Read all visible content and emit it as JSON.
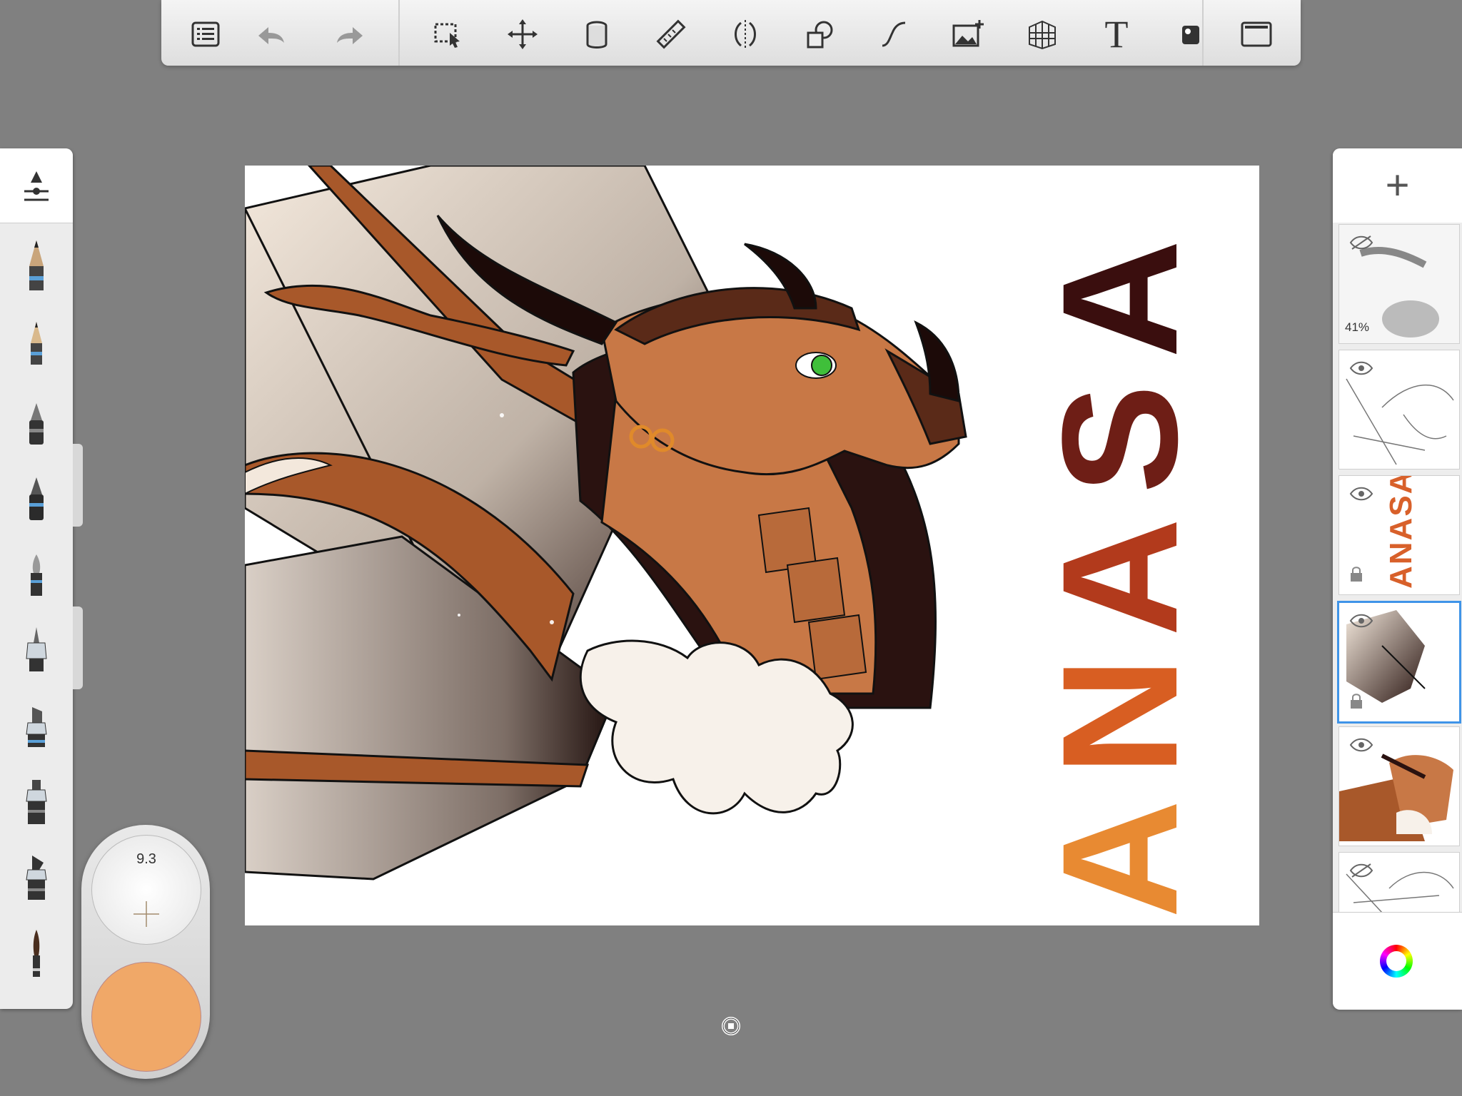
{
  "toolbar": {
    "tools": [
      {
        "name": "layer-list-icon"
      },
      {
        "name": "undo-icon"
      },
      {
        "name": "redo-icon"
      },
      {
        "name": "selection-icon"
      },
      {
        "name": "transform-icon"
      },
      {
        "name": "fill-icon"
      },
      {
        "name": "ruler-icon"
      },
      {
        "name": "symmetry-icon"
      },
      {
        "name": "shape-icon"
      },
      {
        "name": "curve-icon"
      },
      {
        "name": "import-image-icon"
      },
      {
        "name": "perspective-grid-icon"
      },
      {
        "name": "text-icon"
      },
      {
        "name": "stencil-icon"
      },
      {
        "name": "fullscreen-icon"
      }
    ],
    "text_tool_glyph": "T"
  },
  "brush_panel": {
    "brushes": [
      "pencil",
      "hard-pencil",
      "ballpoint-pen",
      "fineliner",
      "paintbrush",
      "airbrush",
      "marker",
      "chisel-marker",
      "wet-brush",
      "ink-brush"
    ]
  },
  "puck": {
    "brush_size": "9.3",
    "current_color": "#f0a868"
  },
  "canvas": {
    "title_letters": [
      "A",
      "N",
      "A",
      "S",
      "A"
    ]
  },
  "layers": {
    "add_label": "+",
    "items": [
      {
        "name": "layer-1",
        "opacity": "41%",
        "visible": false
      },
      {
        "name": "layer-2",
        "visible": true
      },
      {
        "name": "layer-3",
        "visible": true,
        "locked": true,
        "preview_text": "ANASA"
      },
      {
        "name": "layer-4",
        "visible": true,
        "locked": true,
        "selected": true
      },
      {
        "name": "layer-5",
        "visible": true
      },
      {
        "name": "layer-6",
        "visible": false
      }
    ]
  },
  "colors": {
    "background": "#808080",
    "selected_layer": "#3f94e8",
    "brush_color": "#f0a868"
  }
}
